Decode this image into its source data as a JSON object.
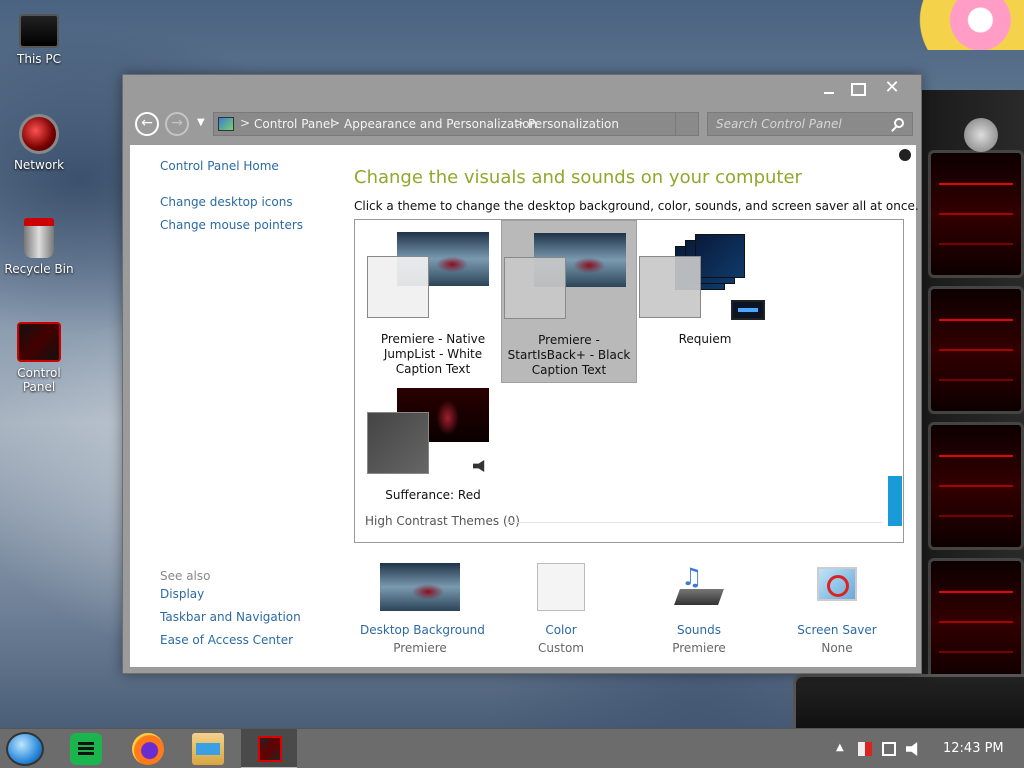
{
  "desktop": {
    "icons": [
      {
        "label": "This PC"
      },
      {
        "label": "Network"
      },
      {
        "label": "Recycle Bin"
      },
      {
        "label": "Control Panel"
      }
    ]
  },
  "window": {
    "address": {
      "crumbs": [
        "Control Panel",
        "Appearance and Personalization",
        "Personalization"
      ],
      "separator": ">"
    },
    "search": {
      "placeholder": "Search Control Panel"
    },
    "sidebar": {
      "home": "Control Panel Home",
      "links": [
        "Change desktop icons",
        "Change mouse pointers"
      ],
      "see_also_label": "See also",
      "see_also": [
        "Display",
        "Taskbar and Navigation",
        "Ease of Access Center"
      ]
    },
    "main": {
      "title": "Change the visuals and sounds on your computer",
      "subtitle": "Click a theme to change the desktop background, color, sounds, and screen saver all at once.",
      "themes": [
        {
          "name": "Premiere - Native JumpList - White Caption Text",
          "selected": false
        },
        {
          "name": "Premiere - StartIsBack+ - Black Caption Text",
          "selected": true
        },
        {
          "name": "Requiem",
          "selected": false
        },
        {
          "name": "Sufferance: Red",
          "selected": false
        }
      ],
      "high_contrast": "High Contrast Themes (0)"
    },
    "bottom": [
      {
        "title": "Desktop Background",
        "value": "Premiere"
      },
      {
        "title": "Color",
        "value": "Custom"
      },
      {
        "title": "Sounds",
        "value": "Premiere"
      },
      {
        "title": "Screen Saver",
        "value": "None"
      }
    ]
  },
  "taskbar": {
    "clock": "12:43 PM"
  }
}
